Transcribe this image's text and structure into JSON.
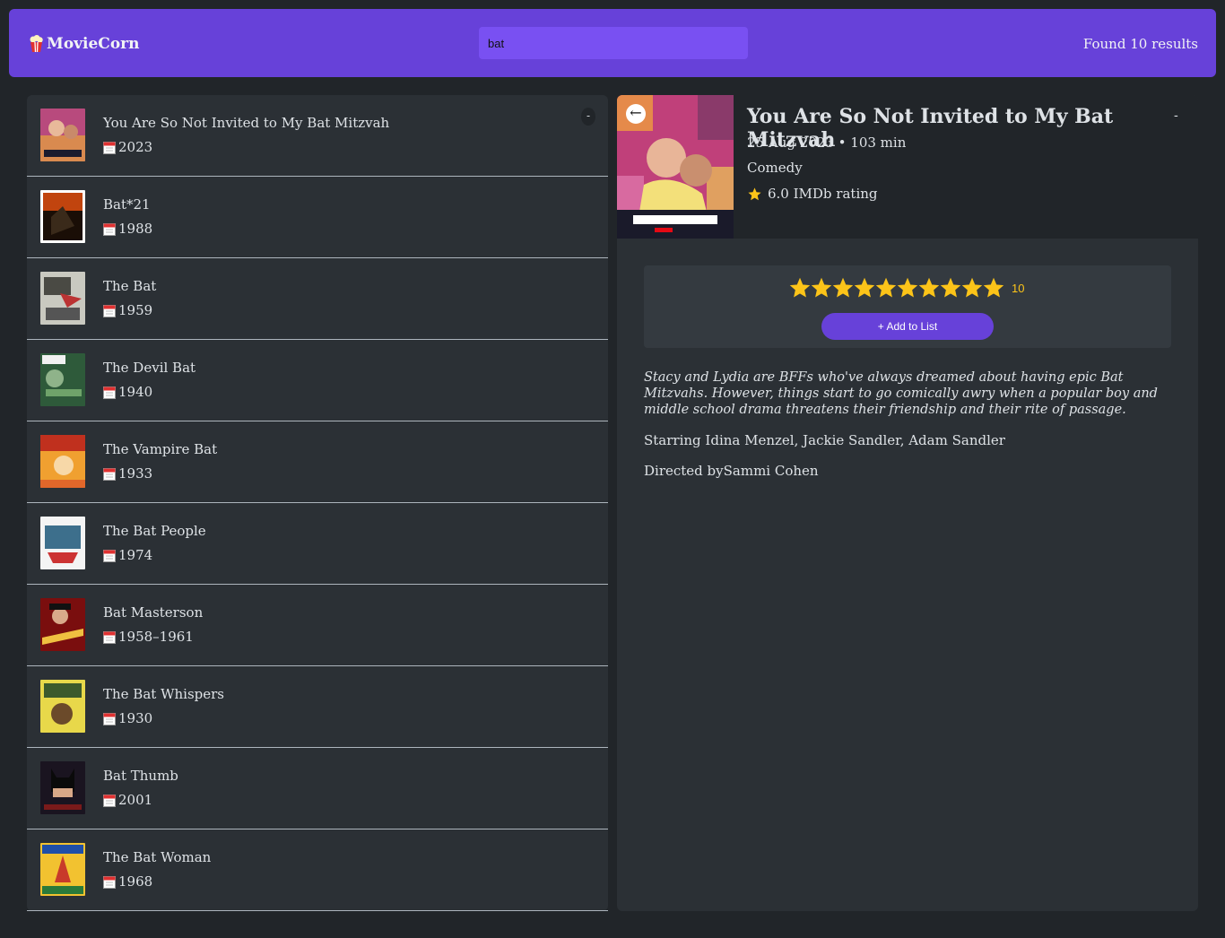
{
  "app": {
    "name": "MovieCorn",
    "search_value": "bat",
    "results_text": "Found 10 results"
  },
  "list": {
    "toggle_label": "-",
    "movies": [
      {
        "title": "You Are So Not Invited to My Bat Mitzvah",
        "year": "2023"
      },
      {
        "title": "Bat*21",
        "year": "1988"
      },
      {
        "title": "The Bat",
        "year": "1959"
      },
      {
        "title": "The Devil Bat",
        "year": "1940"
      },
      {
        "title": "The Vampire Bat",
        "year": "1933"
      },
      {
        "title": "The Bat People",
        "year": "1974"
      },
      {
        "title": "Bat Masterson",
        "year": "1958–1961"
      },
      {
        "title": "The Bat Whispers",
        "year": "1930"
      },
      {
        "title": "Bat Thumb",
        "year": "2001"
      },
      {
        "title": "The Bat Woman",
        "year": "1968"
      }
    ]
  },
  "detail": {
    "back_label": "←",
    "title": "You Are So Not Invited to My Bat Mitzvah",
    "toggle_label": "-",
    "meta": "25 Aug 2023 • 103 min",
    "genre": "Comedy",
    "rating_text": "6.0 IMDb rating",
    "user_rating": {
      "max": 10,
      "value": 10,
      "value_label": "10"
    },
    "add_button": "+ Add to List",
    "plot": "Stacy and Lydia are BFFs who've always dreamed about having epic Bat Mitzvahs. However, things start to go comically awry when a popular boy and middle school drama threatens their friendship and their rite of passage.",
    "starring": "Starring Idina Menzel, Jackie Sandler, Adam Sandler",
    "directed": "Directed bySammi Cohen"
  },
  "colors": {
    "accent": "#6741d9",
    "accent_light": "#7950f2",
    "background": "#212529",
    "panel": "#2b3035",
    "star": "#fcc419"
  },
  "icons": {
    "logo": "popcorn-icon",
    "year": "calendar-icon",
    "rating": "star-icon"
  }
}
